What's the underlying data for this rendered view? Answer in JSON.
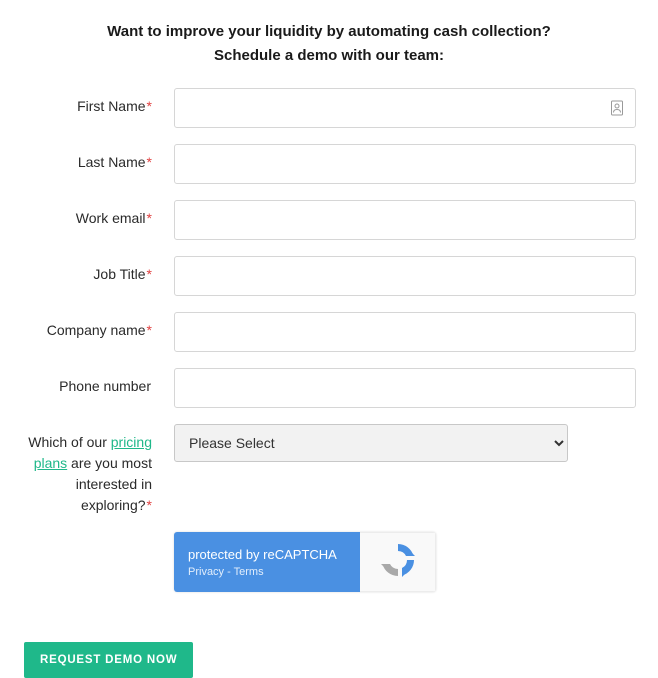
{
  "heading_line1": "Want to improve your liquidity by automating cash collection?",
  "heading_line2": "Schedule a demo with our team:",
  "fields": {
    "first_name": {
      "label": "First Name",
      "required": "*"
    },
    "last_name": {
      "label": "Last Name",
      "required": "*"
    },
    "work_email": {
      "label": "Work email",
      "required": "*"
    },
    "job_title": {
      "label": "Job Title",
      "required": "*"
    },
    "company_name": {
      "label": "Company name",
      "required": "*"
    },
    "phone_number": {
      "label": "Phone number",
      "required": ""
    },
    "pricing_question": {
      "prefix": "Which of our ",
      "link_text": "pricing plans",
      "suffix": " are you most interested in exploring?",
      "required": "*",
      "selected": "Please Select"
    }
  },
  "recaptcha": {
    "title": "protected by reCAPTCHA",
    "privacy": "Privacy",
    "separator": " - ",
    "terms": "Terms"
  },
  "submit_label": "REQUEST DEMO NOW",
  "colors": {
    "accent": "#1fb88a",
    "recaptcha_blue": "#4a90e2"
  }
}
